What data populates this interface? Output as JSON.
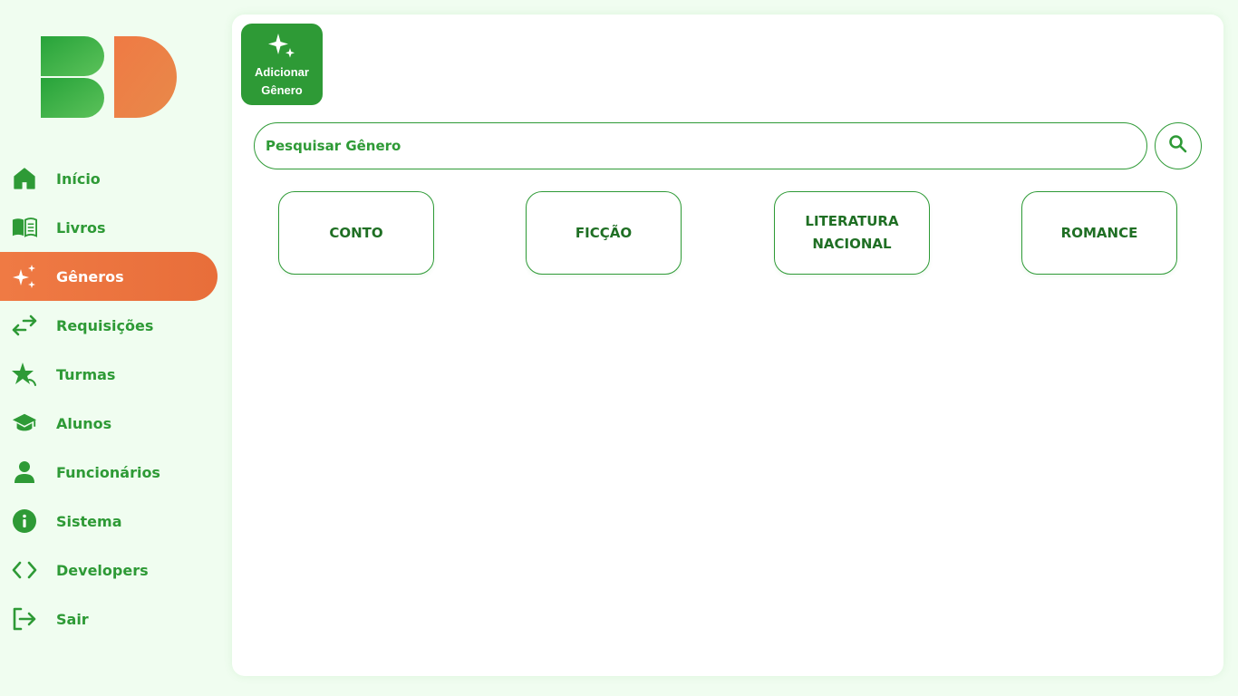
{
  "logo": {
    "letters": "BD",
    "green": "#2e9a36",
    "orange": "#ef7a44"
  },
  "sidebar": {
    "items": [
      {
        "label": "Início",
        "icon": "home-icon",
        "active": false
      },
      {
        "label": "Livros",
        "icon": "book-icon",
        "active": false
      },
      {
        "label": "Gêneros",
        "icon": "sparkles-icon",
        "active": true
      },
      {
        "label": "Requisições",
        "icon": "swap-arrows-icon",
        "active": false
      },
      {
        "label": "Turmas",
        "icon": "star-icon",
        "active": false
      },
      {
        "label": "Alunos",
        "icon": "graduation-cap-icon",
        "active": false
      },
      {
        "label": "Funcionários",
        "icon": "person-icon",
        "active": false
      },
      {
        "label": "Sistema",
        "icon": "info-icon",
        "active": false
      },
      {
        "label": "Developers",
        "icon": "code-icon",
        "active": false
      },
      {
        "label": "Sair",
        "icon": "logout-icon",
        "active": false
      }
    ]
  },
  "toolbar": {
    "add_label_line1": "Adicionar",
    "add_label_line2": "Gênero"
  },
  "search": {
    "placeholder": "Pesquisar Gênero",
    "value": ""
  },
  "genres": [
    {
      "label": "CONTO"
    },
    {
      "label": "FICÇÃO"
    },
    {
      "label": "LITERATURA NACIONAL"
    },
    {
      "label": "ROMANCE"
    }
  ],
  "colors": {
    "accent": "#2e9a36",
    "active": "#ef7a44",
    "card_text": "#1f6f24",
    "background": "#f0fdf0"
  }
}
